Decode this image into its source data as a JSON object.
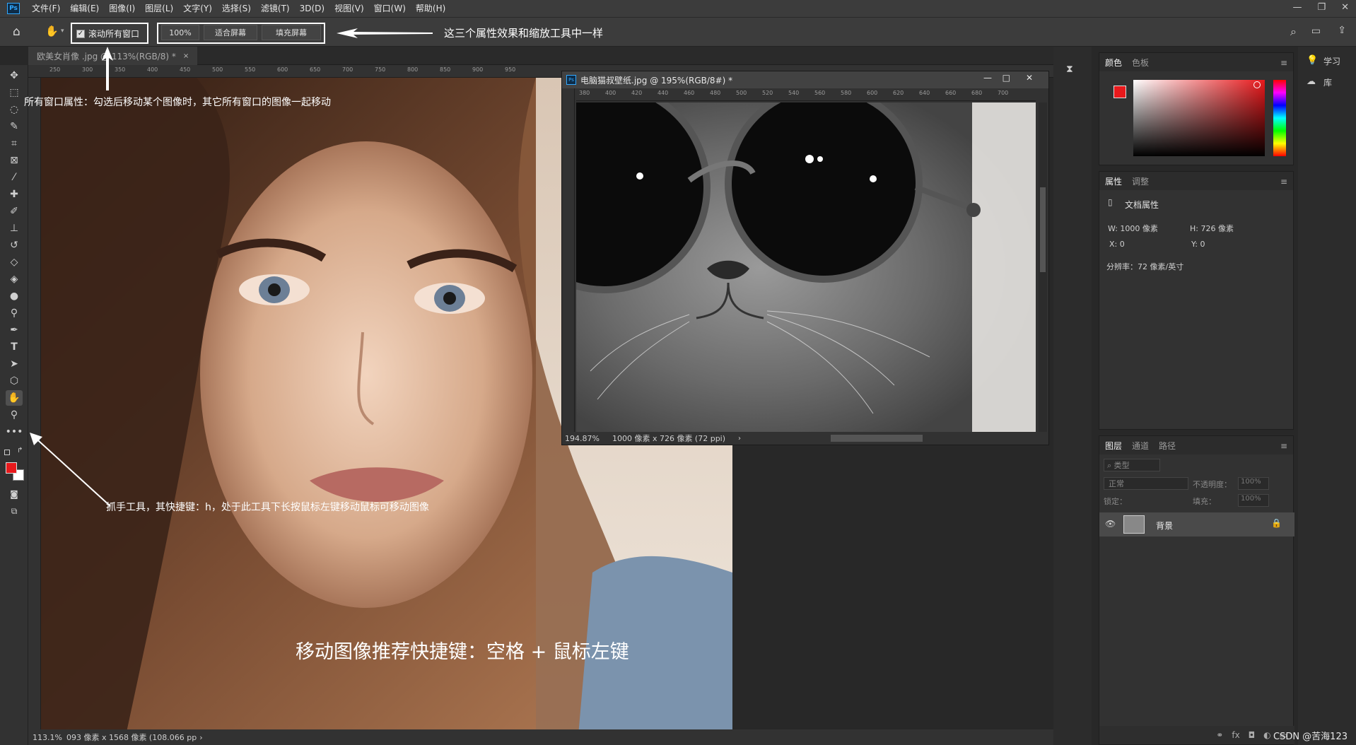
{
  "menu": {
    "app_logo": "Ps",
    "items": [
      "文件(F)",
      "编辑(E)",
      "图像(I)",
      "图层(L)",
      "文字(Y)",
      "选择(S)",
      "滤镜(T)",
      "3D(D)",
      "视图(V)",
      "窗口(W)",
      "帮助(H)"
    ]
  },
  "options": {
    "scroll_all_label": "滚动所有窗口",
    "btn_100": "100%",
    "btn_fit": "适合屏幕",
    "btn_fill": "填充屏幕",
    "annot_top": "这三个属性效果和缩放工具中一样"
  },
  "annotations": {
    "scroll_all": "所有窗口属性：勾选后移动某个图像时，其它所有窗口的图像一起移动",
    "hand_tool": "抓手工具，其快捷键：h，处于此工具下长按鼠标左键移动鼠标可移动图像",
    "recommend": "移动图像推荐快捷键：空格 + 鼠标左键"
  },
  "doc1": {
    "tab": "欧美女肖像 .jpg @ 113%(RGB/8) *",
    "status_zoom": "113.1%",
    "status_info": "093 像素 x 1568 像素 (108.066 pp",
    "ruler": [
      "250",
      "300",
      "350",
      "400",
      "450",
      "500",
      "550",
      "600",
      "650",
      "700",
      "750",
      "800",
      "850",
      "900",
      "950"
    ]
  },
  "doc2": {
    "title": "电脑猫叔壁纸.jpg @ 195%(RGB/8#) *",
    "status_zoom": "194.87%",
    "status_info": "1000 像素 x 726 像素 (72 ppi)",
    "ruler": [
      "380",
      "400",
      "420",
      "440",
      "460",
      "480",
      "500",
      "520",
      "540",
      "560",
      "580",
      "600",
      "620",
      "640",
      "660",
      "680",
      "700"
    ]
  },
  "color_panel": {
    "tab1": "颜色",
    "tab2": "色板"
  },
  "props_panel": {
    "tab1": "属性",
    "tab2": "调整",
    "doc_props": "文档属性",
    "w": "W:  1000 像素",
    "h": "H:  726 像素",
    "x": "X:  0",
    "y": "Y:  0",
    "resolution": "分辨率：72 像素/英寸"
  },
  "layers_panel": {
    "tab1": "图层",
    "tab2": "通道",
    "tab3": "路径",
    "filter": "类型",
    "blend": "正常",
    "opacity_label": "不透明度：",
    "opacity_val": "100%",
    "lock_label": "锁定：",
    "fill_label": "填充：",
    "fill_val": "100%",
    "layer_name": "背景"
  },
  "side_panel": {
    "learn": "学习",
    "library": "库"
  },
  "watermark": "CSDN @苦海123",
  "colors": {
    "foreground": "#e8191c",
    "background": "#ffffff"
  }
}
